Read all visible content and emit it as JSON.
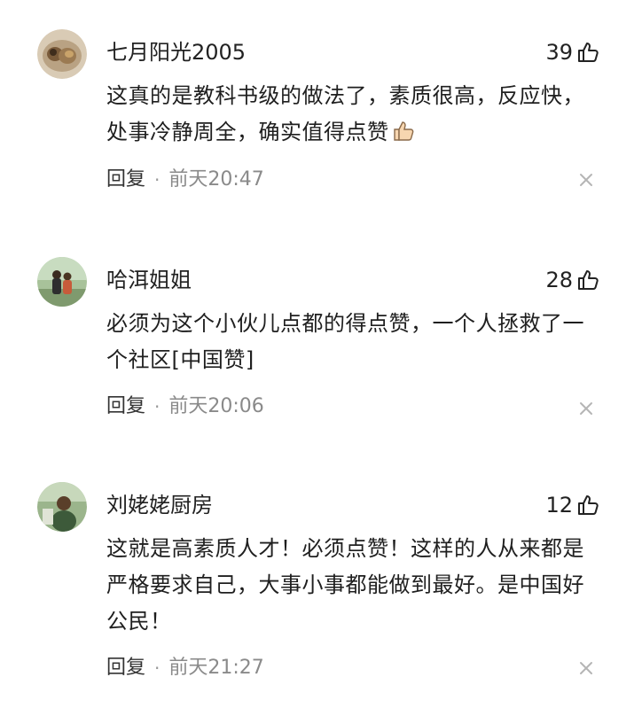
{
  "comments": [
    {
      "username": "七月阳光2005",
      "likes": "39",
      "text": "这真的是教科书级的做法了，素质很高，反应快，处事冷静周全，确实值得点赞",
      "has_emoji": true,
      "reply_label": "回复",
      "separator": "·",
      "time": "前天20:47",
      "avatar_color": "#8a6a48"
    },
    {
      "username": "哈洱姐姐",
      "likes": "28",
      "text": "必须为这个小伙儿点都的得点赞，一个人拯救了一个社区[中国赞]",
      "has_emoji": false,
      "reply_label": "回复",
      "separator": "·",
      "time": "前天20:06",
      "avatar_color": "#6d8a5a"
    },
    {
      "username": "刘姥姥厨房",
      "likes": "12",
      "text": "这就是高素质人才！必须点赞！这样的人从来都是严格要求自己，大事小事都能做到最好。是中国好公民！",
      "has_emoji": false,
      "reply_label": "回复",
      "separator": "·",
      "time": "前天21:27",
      "avatar_color": "#5e7a56"
    }
  ]
}
